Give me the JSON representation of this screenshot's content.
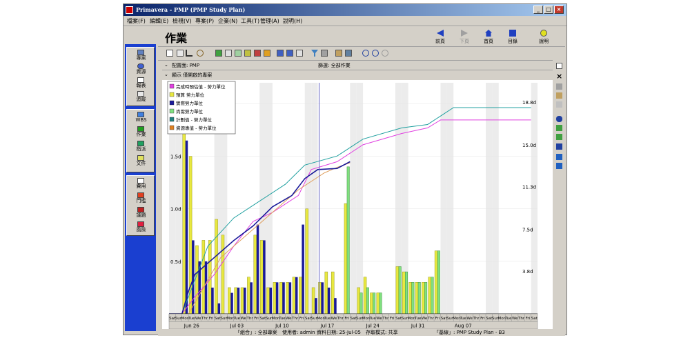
{
  "window": {
    "title": "Primavera - PMP (PMP Study Plan)",
    "controls": [
      "_",
      "□",
      "×"
    ]
  },
  "menu": [
    "檔案(F)",
    "編輯(E)",
    "檢視(V)",
    "專案(P)",
    "企業(N)",
    "工具(T)",
    "管理(A)",
    "說明(H)"
  ],
  "sidebar": {
    "items": [
      {
        "label": "專案",
        "icon": "project-icon"
      },
      {
        "label": "資源",
        "icon": "resource-icon"
      },
      {
        "label": "報表",
        "icon": "report-icon"
      },
      {
        "label": "追蹤",
        "icon": "tracking-icon"
      },
      {
        "label": "WBS",
        "icon": "wbs-icon"
      },
      {
        "label": "作業",
        "icon": "activity-icon"
      },
      {
        "label": "指派",
        "icon": "assignment-icon"
      },
      {
        "label": "文件",
        "icon": "document-icon"
      },
      {
        "label": "費用",
        "icon": "expense-icon"
      },
      {
        "label": "門檻",
        "icon": "threshold-icon"
      },
      {
        "label": "議題",
        "icon": "issue-icon"
      },
      {
        "label": "風險",
        "icon": "risk-icon"
      }
    ]
  },
  "header": {
    "title": "作業",
    "nav": [
      {
        "label": "前頁",
        "icon": "back-icon"
      },
      {
        "label": "下頁",
        "icon": "forward-icon"
      },
      {
        "label": "首頁",
        "icon": "home-icon"
      },
      {
        "label": "目錄",
        "icon": "directory-icon"
      },
      {
        "label": "說明",
        "icon": "help-icon"
      }
    ]
  },
  "filterbar": {
    "layout": "配置面: PMP",
    "filter": "篩選: 全部作業"
  },
  "legendbar": {
    "label": "顯示 僅開啟的專案"
  },
  "statusbar": {
    "portfolio": "「組合」: 全部專案",
    "user": "使用者: admin",
    "data_date": "資料日期: 25-Jul-05",
    "access_mode": "存取模式: 共享",
    "baseline": "「基線」: PMP Study Plan - B3"
  },
  "chart_data": {
    "type": "bar",
    "legend": [
      {
        "name": "完成時預估值 - 勞力單位",
        "color": "#e040e0"
      },
      {
        "name": "預算 勞力單位",
        "color": "#e8e840"
      },
      {
        "name": "實際勞力單位",
        "color": "#1a1a9a"
      },
      {
        "name": "尚需勞力單位",
        "color": "#80e080"
      },
      {
        "name": "計劃值 - 勞力單位",
        "color": "#208080"
      },
      {
        "name": "資源專值 - 勞力單位",
        "color": "#e08020"
      }
    ],
    "legend_position": "top-left",
    "y_left_ticks": [
      "0.5d",
      "1.0d",
      "1.5d",
      "2.0d"
    ],
    "y_left_values": [
      0.5,
      1.0,
      1.5,
      2.0
    ],
    "y_left_range": [
      0,
      2.2
    ],
    "y_right_ticks": [
      "3.8d",
      "7.5d",
      "11.3d",
      "15.0d",
      "18.8d"
    ],
    "y_right_values": [
      3.8,
      7.5,
      11.3,
      15.0,
      18.8
    ],
    "y_right_range": [
      0,
      20.5
    ],
    "day_labels": [
      "Sat",
      "Sun",
      "Mon",
      "Tue",
      "We",
      "Thr",
      "Fri",
      "Sat",
      "Sun",
      "Mon",
      "Tue",
      "We",
      "Thr",
      "Fri",
      "Sat",
      "Sun",
      "Mon",
      "Tue",
      "We",
      "Thr",
      "Fri",
      "Sat",
      "Sun",
      "Mon",
      "Tue",
      "We",
      "Thr",
      "Fri",
      "Sat",
      "Sun",
      "Mon",
      "Tue",
      "We",
      "Thr",
      "Fri",
      "Sat",
      "Sun",
      "Mon",
      "Tue",
      "We",
      "Thr",
      "Fri",
      "Sat",
      "Sun",
      "Mon",
      "Tue",
      "We",
      "Thr",
      "Fri",
      "Sat",
      "Sun",
      "Mon",
      "Tue",
      "We",
      "Thr",
      "Fri",
      "Sat"
    ],
    "week_labels": [
      "Jun 26",
      "Jul 03",
      "Jul 10",
      "Jul 17",
      "Jul 24",
      "Jul 31",
      "Aug 07"
    ],
    "data_date_index": 23,
    "bars": [
      {
        "day": 2,
        "budget": 2.0,
        "actual": 1.65,
        "remaining": 0
      },
      {
        "day": 3,
        "budget": 1.5,
        "actual": 0.7,
        "remaining": 0
      },
      {
        "day": 4,
        "budget": 0.65,
        "actual": 0.5,
        "remaining": 0
      },
      {
        "day": 5,
        "budget": 0.7,
        "actual": 0.5,
        "remaining": 0
      },
      {
        "day": 6,
        "budget": 0.7,
        "actual": 0.25,
        "remaining": 0
      },
      {
        "day": 7,
        "budget": 0.9,
        "actual": 0.1,
        "remaining": 0
      },
      {
        "day": 8,
        "budget": 0.75,
        "actual": 0,
        "remaining": 0
      },
      {
        "day": 9,
        "budget": 0.25,
        "actual": 0.2,
        "remaining": 0
      },
      {
        "day": 10,
        "budget": 0.25,
        "actual": 0.25,
        "remaining": 0
      },
      {
        "day": 11,
        "budget": 0.25,
        "actual": 0.25,
        "remaining": 0
      },
      {
        "day": 12,
        "budget": 0.35,
        "actual": 0.3,
        "remaining": 0
      },
      {
        "day": 13,
        "budget": 0.75,
        "actual": 0.85,
        "remaining": 0
      },
      {
        "day": 14,
        "budget": 0.7,
        "actual": 0.7,
        "remaining": 0
      },
      {
        "day": 15,
        "budget": 0.25,
        "actual": 0.25,
        "remaining": 0
      },
      {
        "day": 16,
        "budget": 0.3,
        "actual": 0.3,
        "remaining": 0
      },
      {
        "day": 17,
        "budget": 0.3,
        "actual": 0.3,
        "remaining": 0
      },
      {
        "day": 18,
        "budget": 0.3,
        "actual": 0.3,
        "remaining": 0
      },
      {
        "day": 19,
        "budget": 0.35,
        "actual": 0.35,
        "remaining": 0
      },
      {
        "day": 20,
        "budget": 0.35,
        "actual": 0.85,
        "remaining": 0
      },
      {
        "day": 21,
        "budget": 1.0,
        "actual": 0,
        "remaining": 0
      },
      {
        "day": 22,
        "budget": 0.25,
        "actual": 0.15,
        "remaining": 0
      },
      {
        "day": 23,
        "budget": 0.3,
        "actual": 0.3,
        "remaining": 0
      },
      {
        "day": 24,
        "budget": 0.4,
        "actual": 0.25,
        "remaining": 0
      },
      {
        "day": 25,
        "budget": 0.4,
        "actual": 0.15,
        "remaining": 0
      },
      {
        "day": 27,
        "budget": 1.05,
        "actual": 0.15,
        "remaining": 1.4
      },
      {
        "day": 29,
        "budget": 0.25,
        "actual": 0,
        "remaining": 0.2
      },
      {
        "day": 30,
        "budget": 0.35,
        "actual": 0,
        "remaining": 0.25
      },
      {
        "day": 31,
        "budget": 0.2,
        "actual": 0,
        "remaining": 0.2
      },
      {
        "day": 32,
        "budget": 0.2,
        "actual": 0,
        "remaining": 0.2
      },
      {
        "day": 35,
        "budget": 0.45,
        "actual": 0,
        "remaining": 0.45
      },
      {
        "day": 36,
        "budget": 0.4,
        "actual": 0,
        "remaining": 0.4
      },
      {
        "day": 37,
        "budget": 0.3,
        "actual": 0,
        "remaining": 0.3
      },
      {
        "day": 38,
        "budget": 0.3,
        "actual": 0,
        "remaining": 0.3
      },
      {
        "day": 39,
        "budget": 0.3,
        "actual": 0,
        "remaining": 0.3
      },
      {
        "day": 40,
        "budget": 0.35,
        "actual": 0,
        "remaining": 0.35
      },
      {
        "day": 41,
        "budget": 0.6,
        "actual": 0,
        "remaining": 0.6
      }
    ],
    "cumulative_lines": [
      {
        "name": "完成時預估值 - 勞力單位",
        "color": "#e040e0",
        "points": [
          [
            0,
            0
          ],
          [
            2,
            0
          ],
          [
            4,
            1.5
          ],
          [
            7,
            3.5
          ],
          [
            10,
            6
          ],
          [
            13,
            8.2
          ],
          [
            16,
            9
          ],
          [
            20,
            10.5
          ],
          [
            22,
            12.8
          ],
          [
            26,
            13.5
          ],
          [
            30,
            15
          ],
          [
            36,
            16
          ],
          [
            40,
            16.5
          ],
          [
            42,
            17.2
          ],
          [
            56,
            17.2
          ]
        ]
      },
      {
        "name": "計劃值 - 勞力單位",
        "color": "#20a0a0",
        "points": [
          [
            0,
            0
          ],
          [
            2,
            0
          ],
          [
            4,
            3
          ],
          [
            6,
            6
          ],
          [
            10,
            8.5
          ],
          [
            14,
            10
          ],
          [
            18,
            11.5
          ],
          [
            21,
            13.2
          ],
          [
            26,
            14
          ],
          [
            30,
            15.5
          ],
          [
            36,
            16.5
          ],
          [
            40,
            16.8
          ],
          [
            44,
            18.3
          ],
          [
            56,
            18.3
          ]
        ]
      },
      {
        "name": "資源專值 - 勞力單位",
        "color": "#e0a060",
        "points": [
          [
            0,
            0
          ],
          [
            3,
            0
          ],
          [
            5,
            2
          ],
          [
            8,
            5
          ],
          [
            12,
            7
          ],
          [
            16,
            9
          ],
          [
            20,
            11
          ],
          [
            24,
            12.5
          ],
          [
            26,
            13
          ],
          [
            28,
            13.4
          ]
        ]
      },
      {
        "name": "實際勞力單位",
        "color": "#1a1a9a",
        "points": [
          [
            0,
            0
          ],
          [
            2,
            0
          ],
          [
            3,
            2
          ],
          [
            4,
            3.5
          ],
          [
            7,
            5
          ],
          [
            10,
            6.5
          ],
          [
            13,
            7.8
          ],
          [
            16,
            9.5
          ],
          [
            19,
            10.5
          ],
          [
            21,
            12
          ],
          [
            23,
            12.8
          ],
          [
            26,
            12.9
          ],
          [
            28,
            13.5
          ]
        ]
      }
    ]
  }
}
